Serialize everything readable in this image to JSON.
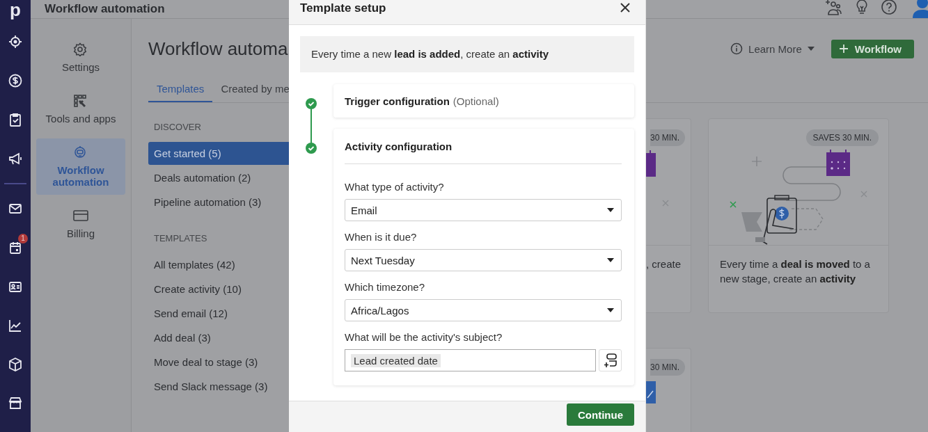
{
  "rail": {
    "logo": "p",
    "badge": "1"
  },
  "header": {
    "title": "Workflow automation"
  },
  "settings_nav": [
    {
      "label": "Settings",
      "selected": false
    },
    {
      "label": "Tools and apps",
      "selected": false
    },
    {
      "label": "Workflow automation",
      "selected": true
    },
    {
      "label": "Billing",
      "selected": false
    }
  ],
  "page": {
    "title": "Workflow automa",
    "learn_more": "Learn More",
    "new_button": "Workflow",
    "tabs": [
      {
        "label": "Templates",
        "selected": true
      },
      {
        "label": "Created by me",
        "selected": false
      }
    ]
  },
  "discover": {
    "heading": "DISCOVER",
    "items": [
      {
        "label": "Get started (5)",
        "selected": true
      },
      {
        "label": "Deals automation (2)",
        "selected": false
      },
      {
        "label": "Pipeline automation (3)",
        "selected": false
      }
    ]
  },
  "templates": {
    "heading": "TEMPLATES",
    "items": [
      {
        "label": "All templates (42)",
        "selected": false
      },
      {
        "label": "Create activity (10)",
        "selected": false
      },
      {
        "label": "Send email (12)",
        "selected": false
      },
      {
        "label": "Add deal (3)",
        "selected": false
      },
      {
        "label": "Move deal to stage (3)",
        "selected": false
      },
      {
        "label": "Send Slack message (3)",
        "selected": false
      }
    ]
  },
  "cards": [
    {
      "badge": "30 MIN.",
      "text": ", create"
    },
    {
      "badge": "SAVES 30 MIN.",
      "text": "Every time a **deal is moved** to a new stage, create an **activity**"
    },
    {
      "badge": "30 MIN."
    }
  ],
  "modal": {
    "title": "Template setup",
    "description": "Every time a new **lead is added**, create an **activity**",
    "steps": [
      {
        "title": "Trigger configuration",
        "note": "(Optional)",
        "done": true
      },
      {
        "title": "Activity configuration",
        "done": true
      }
    ],
    "fields": [
      {
        "kind": "select",
        "label": "What type of activity?",
        "value": "Email"
      },
      {
        "kind": "select",
        "label": "When is it due?",
        "value": "Next Tuesday"
      },
      {
        "kind": "select",
        "label": "Which timezone?",
        "value": "Africa/Lagos"
      },
      {
        "kind": "token",
        "label": "What will be the activity's subject?",
        "value": "Lead created date"
      }
    ],
    "button": "Continue"
  }
}
